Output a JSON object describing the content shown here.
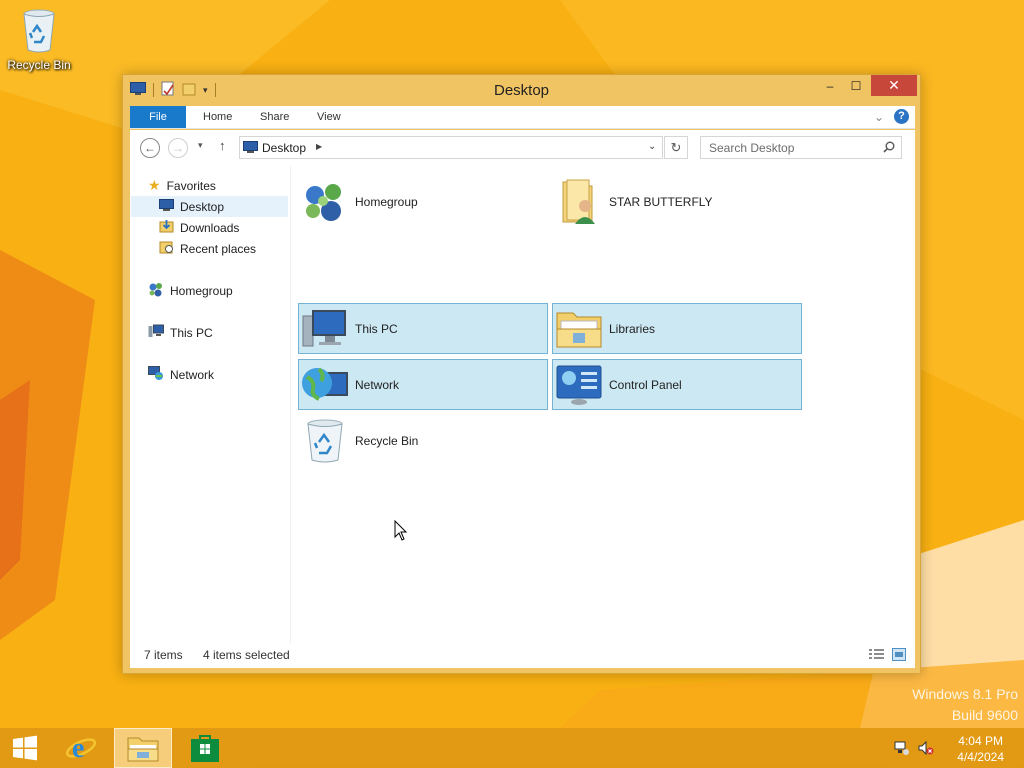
{
  "desktop": {
    "icon_label": "Recycle Bin",
    "watermark_line1": "Windows 8.1 Pro",
    "watermark_line2": "Build 9600"
  },
  "window": {
    "title": "Desktop",
    "buttons": {
      "minimize": "–",
      "maximize": "☐",
      "close": "✕"
    },
    "ribbon_tabs": [
      "File",
      "Home",
      "Share",
      "View"
    ],
    "address_path": "Desktop",
    "search_placeholder": "Search Desktop"
  },
  "nav_pane": {
    "items": [
      {
        "label": "Favorites",
        "icon": "star-icon"
      },
      {
        "label": "Desktop",
        "icon": "desktop-icon",
        "selected": true
      },
      {
        "label": "Downloads",
        "icon": "downloads-icon"
      },
      {
        "label": "Recent places",
        "icon": "recent-places-icon"
      },
      {
        "label": "Homegroup",
        "icon": "homegroup-icon"
      },
      {
        "label": "This PC",
        "icon": "pc-icon"
      },
      {
        "label": "Network",
        "icon": "network-icon"
      }
    ]
  },
  "items": [
    {
      "label": "Homegroup",
      "icon": "homegroup-icon",
      "selected": false
    },
    {
      "label": "STAR BUTTERFLY",
      "icon": "user-folder-icon",
      "selected": false
    },
    {
      "label": "This PC",
      "icon": "pc-icon",
      "selected": true
    },
    {
      "label": "Libraries",
      "icon": "libraries-icon",
      "selected": true
    },
    {
      "label": "Network",
      "icon": "network-globe-icon",
      "selected": true
    },
    {
      "label": "Control Panel",
      "icon": "control-panel-icon",
      "selected": true
    },
    {
      "label": "Recycle Bin",
      "icon": "recycle-bin-icon",
      "selected": false
    }
  ],
  "status": {
    "count": "7 items",
    "selected": "4 items selected"
  },
  "taskbar": {
    "time": "4:04 PM",
    "date": "4/4/2024"
  },
  "colors": {
    "window_frame": "#f1c463",
    "file_tab": "#1979ca",
    "close_button": "#c7473b",
    "selection_fill": "#cce8f3",
    "taskbar": "#de9614"
  }
}
